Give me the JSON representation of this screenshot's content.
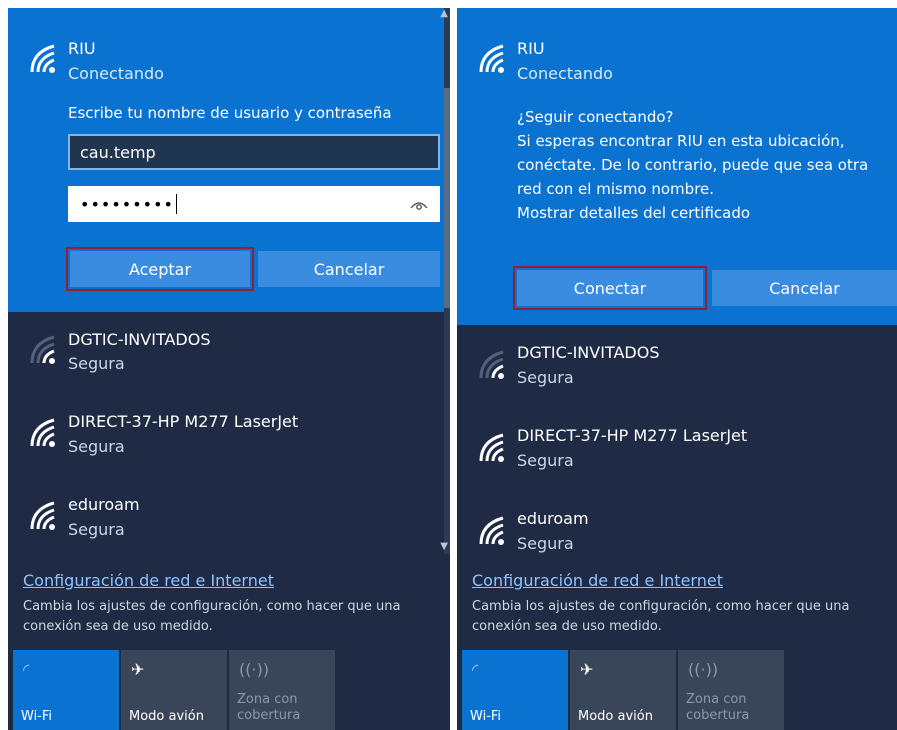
{
  "left": {
    "network": {
      "name": "RIU",
      "status": "Conectando"
    },
    "prompt": "Escribe tu nombre de usuario y contraseña",
    "username": "cau.temp",
    "password_mask": "•••••••••",
    "buttons": {
      "accept": "Aceptar",
      "cancel": "Cancelar"
    }
  },
  "right": {
    "network": {
      "name": "RIU",
      "status": "Conectando"
    },
    "message_lines": [
      "¿Seguir conectando?",
      "Si esperas encontrar RIU en esta ubicación,",
      "conéctate. De lo contrario, puede que sea otra",
      "red con el mismo nombre.",
      "Mostrar detalles del certificado"
    ],
    "buttons": {
      "connect": "Conectar",
      "cancel": "Cancelar"
    }
  },
  "networks": [
    {
      "name": "DGTIC-INVITADOS",
      "security": "Segura"
    },
    {
      "name": "DIRECT-37-HP M277 LaserJet",
      "security": "Segura"
    },
    {
      "name": "eduroam",
      "security": "Segura"
    }
  ],
  "settings": {
    "link": "Configuración de red e Internet",
    "description_line1": "Cambia los ajustes de configuración, como hacer que una",
    "description_line2": "conexión sea de uso medido."
  },
  "quick_actions": [
    {
      "label": "Wi-Fi",
      "icon": "wifi-icon",
      "active": true
    },
    {
      "label": "Modo avión",
      "icon": "airplane-icon",
      "active": false
    },
    {
      "label": "Zona con cobertura",
      "icon": "hotspot-icon",
      "active": false
    }
  ],
  "colors": {
    "accent": "#0a73d1",
    "panel": "#1f2b45",
    "highlight": "#9b1b30"
  }
}
